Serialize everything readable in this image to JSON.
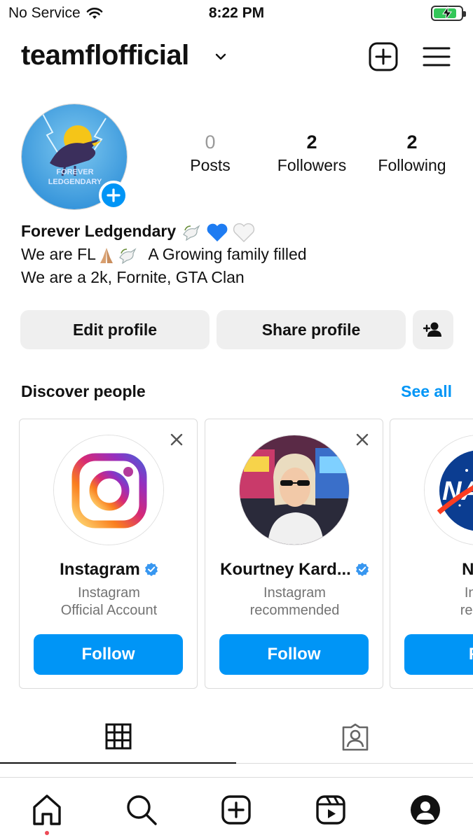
{
  "status_bar": {
    "carrier": "No Service",
    "time": "8:22 PM"
  },
  "header": {
    "username": "teamflofficial"
  },
  "profile": {
    "stats": [
      {
        "value": "0",
        "label": "Posts"
      },
      {
        "value": "2",
        "label": "Followers"
      },
      {
        "value": "2",
        "label": "Following"
      }
    ],
    "bio": {
      "name": "Forever Ledgendary",
      "line1": "We are FL",
      "line1_rest": "A Growing family filled",
      "line2": "We are a 2k, Fornite, GTA Clan"
    },
    "avatar_text": [
      "FOREVER",
      "LEDGENDARY"
    ]
  },
  "buttons": {
    "edit": "Edit profile",
    "share": "Share profile"
  },
  "discover": {
    "title": "Discover people",
    "see_all": "See all",
    "cards": [
      {
        "name": "Instagram",
        "sub1": "Instagram",
        "sub2": "Official Account",
        "follow": "Follow"
      },
      {
        "name": "Kourtney Kard...",
        "sub1": "Instagram",
        "sub2": "recommended",
        "follow": "Follow"
      },
      {
        "name": "NAS",
        "sub1": "Insta",
        "sub2": "recom",
        "follow": "Fo"
      }
    ]
  },
  "colors": {
    "accent": "#0095f6",
    "battery": "#34c759",
    "notification_dot": "#ed4956"
  }
}
